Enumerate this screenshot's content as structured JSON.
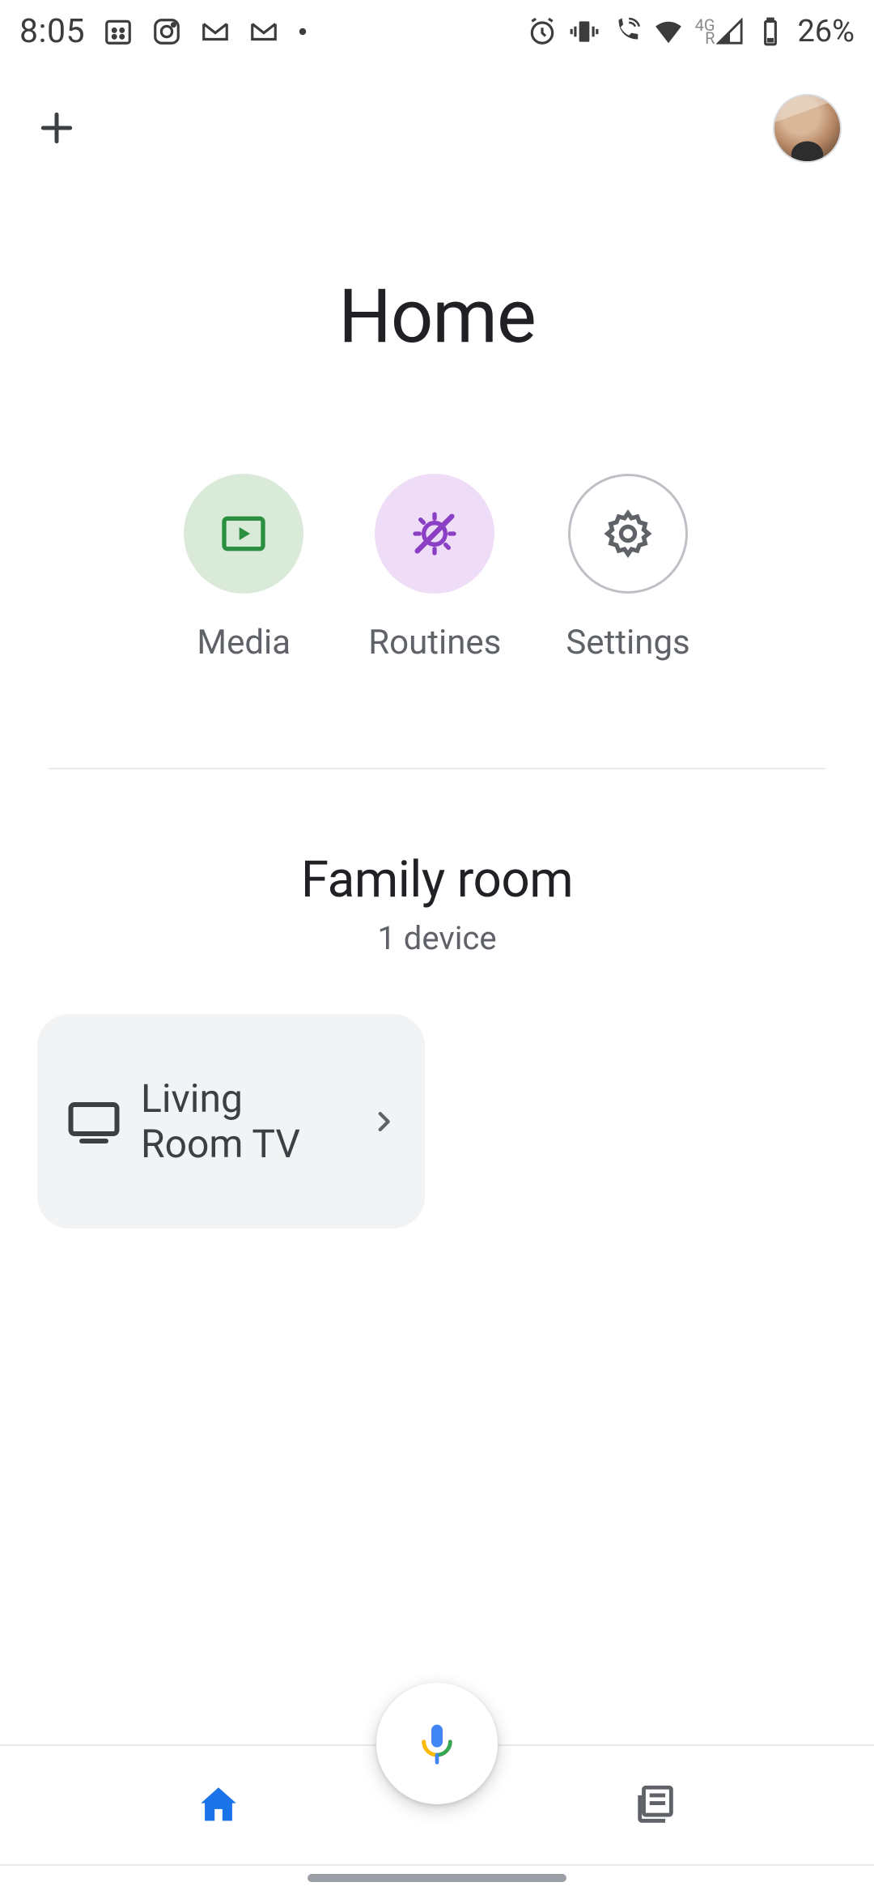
{
  "status": {
    "time": "8:05",
    "battery_pct": "26%",
    "network_label": "4G",
    "roaming_label": "R"
  },
  "header": {
    "title": "Home"
  },
  "quick_actions": [
    {
      "id": "media",
      "label": "Media"
    },
    {
      "id": "routines",
      "label": "Routines"
    },
    {
      "id": "settings",
      "label": "Settings"
    }
  ],
  "room": {
    "name": "Family room",
    "subtitle": "1 device",
    "devices": [
      {
        "name": "Living Room TV"
      }
    ]
  },
  "nav": {
    "home_selected": true
  }
}
